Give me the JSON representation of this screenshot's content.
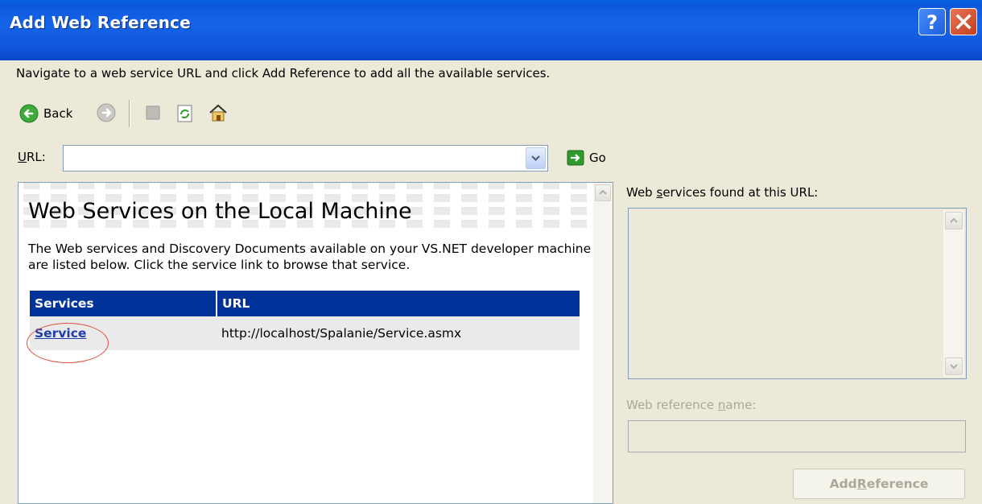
{
  "window": {
    "title": "Add Web Reference"
  },
  "instructions": "Navigate to a web service URL and click Add Reference to add all the available services.",
  "toolbar": {
    "back_label": "Back"
  },
  "url_row": {
    "label_accel": "U",
    "label_rest": "RL:",
    "value": "",
    "go_label": "Go"
  },
  "browser": {
    "title": "Web Services on the Local Machine",
    "description": "The Web services and Discovery Documents available on your VS.NET developer machine are listed below. Click the service link to browse that service.",
    "table": {
      "headers": [
        "Services",
        "URL"
      ],
      "rows": [
        {
          "service": "Service",
          "url": "http://localhost/Spalanie/Service.asmx"
        }
      ]
    }
  },
  "right_panel": {
    "found_label_pre": "Web ",
    "found_label_accel": "s",
    "found_label_post": "ervices found at this URL:",
    "ref_name_label_pre": "Web reference ",
    "ref_name_label_accel": "n",
    "ref_name_label_post": "ame:",
    "ref_name_value": "",
    "add_ref_pre": "Add ",
    "add_ref_accel": "R",
    "add_ref_post": "eference"
  },
  "colors": {
    "titlebar": "#0B58DC",
    "table_header": "#003399",
    "link": "#1F3BAE",
    "annotation_circle": "#E0503A",
    "disabled_text": "#ACA899"
  }
}
